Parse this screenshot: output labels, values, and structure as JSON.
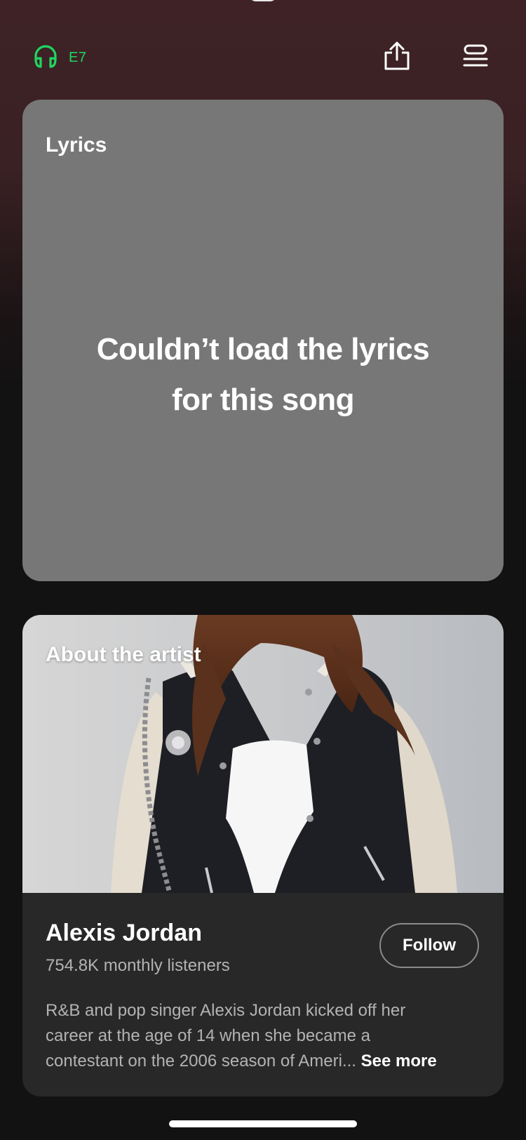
{
  "top_bar": {
    "device_label": "E7",
    "device_icon": "headphones-icon",
    "share_icon": "share-icon",
    "queue_icon": "queue-icon"
  },
  "lyrics": {
    "title": "Lyrics",
    "error_line1": "Couldn’t load the lyrics",
    "error_line2": "for this song"
  },
  "artist": {
    "section_title": "About the artist",
    "name": "Alexis Jordan",
    "listeners": "754.8K monthly listeners",
    "follow_label": "Follow",
    "bio_line1": "R&B and pop singer Alexis Jordan kicked off her",
    "bio_line2": "career at the age of 14 when she became a",
    "bio_line3": "contestant on the 2006 season of Ameri...",
    "see_more": "See more"
  },
  "colors": {
    "accent": "#1ed760",
    "lyrics_card": "#777777",
    "artist_card": "#282828",
    "secondary_text": "#b3b3b3"
  }
}
